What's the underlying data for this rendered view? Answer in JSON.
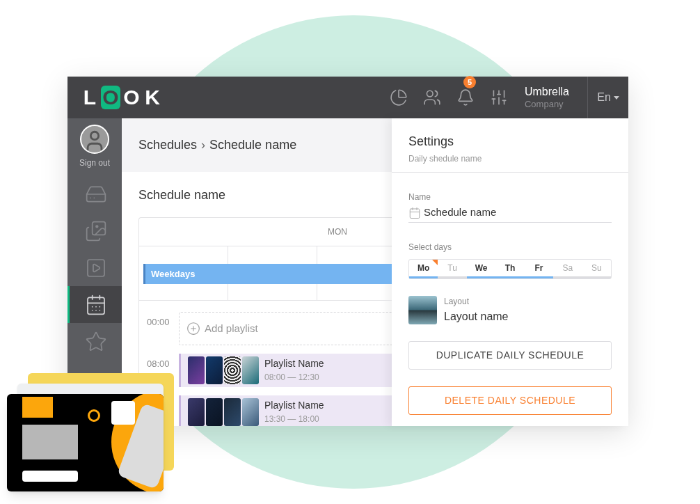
{
  "header": {
    "logo": [
      {
        "char": "L",
        "highlighted": false
      },
      {
        "char": "O",
        "highlighted": true
      },
      {
        "char": "O",
        "highlighted": false
      },
      {
        "char": "K",
        "highlighted": false
      }
    ],
    "notification_count": "5",
    "account": {
      "name": "Umbrella",
      "subtitle": "Company"
    },
    "language": "En"
  },
  "sidebar": {
    "user_action": "Sign out",
    "items": [
      {
        "kind": "screens",
        "selected": false
      },
      {
        "kind": "images",
        "selected": false
      },
      {
        "kind": "videos",
        "selected": false
      },
      {
        "kind": "schedules",
        "selected": true
      },
      {
        "kind": "favorites",
        "selected": false
      }
    ]
  },
  "breadcrumb": {
    "items": [
      "Schedules",
      "Schedule name"
    ],
    "separator": "›"
  },
  "schedule": {
    "title": "Schedule name",
    "day_header": "MON",
    "event_bar": "Weekdays",
    "slots": [
      {
        "kind": "add",
        "time": "00:00",
        "label": "Add playlist"
      },
      {
        "kind": "playlist",
        "time": "08:00",
        "name": "Playlist Name",
        "range": "08:00 — 12:30"
      },
      {
        "kind": "playlist",
        "name": "Playlist Name",
        "range": "13:30 — 18:00"
      }
    ]
  },
  "settings": {
    "title": "Settings",
    "subtitle": "Daily shedule name",
    "name_label": "Name",
    "name_value": "Schedule name",
    "days_label": "Select days",
    "days": [
      {
        "label": "Mo",
        "selected": true,
        "today": true
      },
      {
        "label": "Tu",
        "selected": false,
        "today": false
      },
      {
        "label": "We",
        "selected": true,
        "today": false
      },
      {
        "label": "Th",
        "selected": true,
        "today": false
      },
      {
        "label": "Fr",
        "selected": true,
        "today": false
      },
      {
        "label": "Sa",
        "selected": false,
        "today": false
      },
      {
        "label": "Su",
        "selected": false,
        "today": false
      }
    ],
    "layout_label": "Layout",
    "layout_name": "Layout name",
    "buttons": [
      {
        "kind": "secondary",
        "label": "DUPLICATE DAILY SCHEDULE"
      },
      {
        "kind": "danger",
        "label": "DELETE DAILY SCHEDULE"
      }
    ]
  }
}
